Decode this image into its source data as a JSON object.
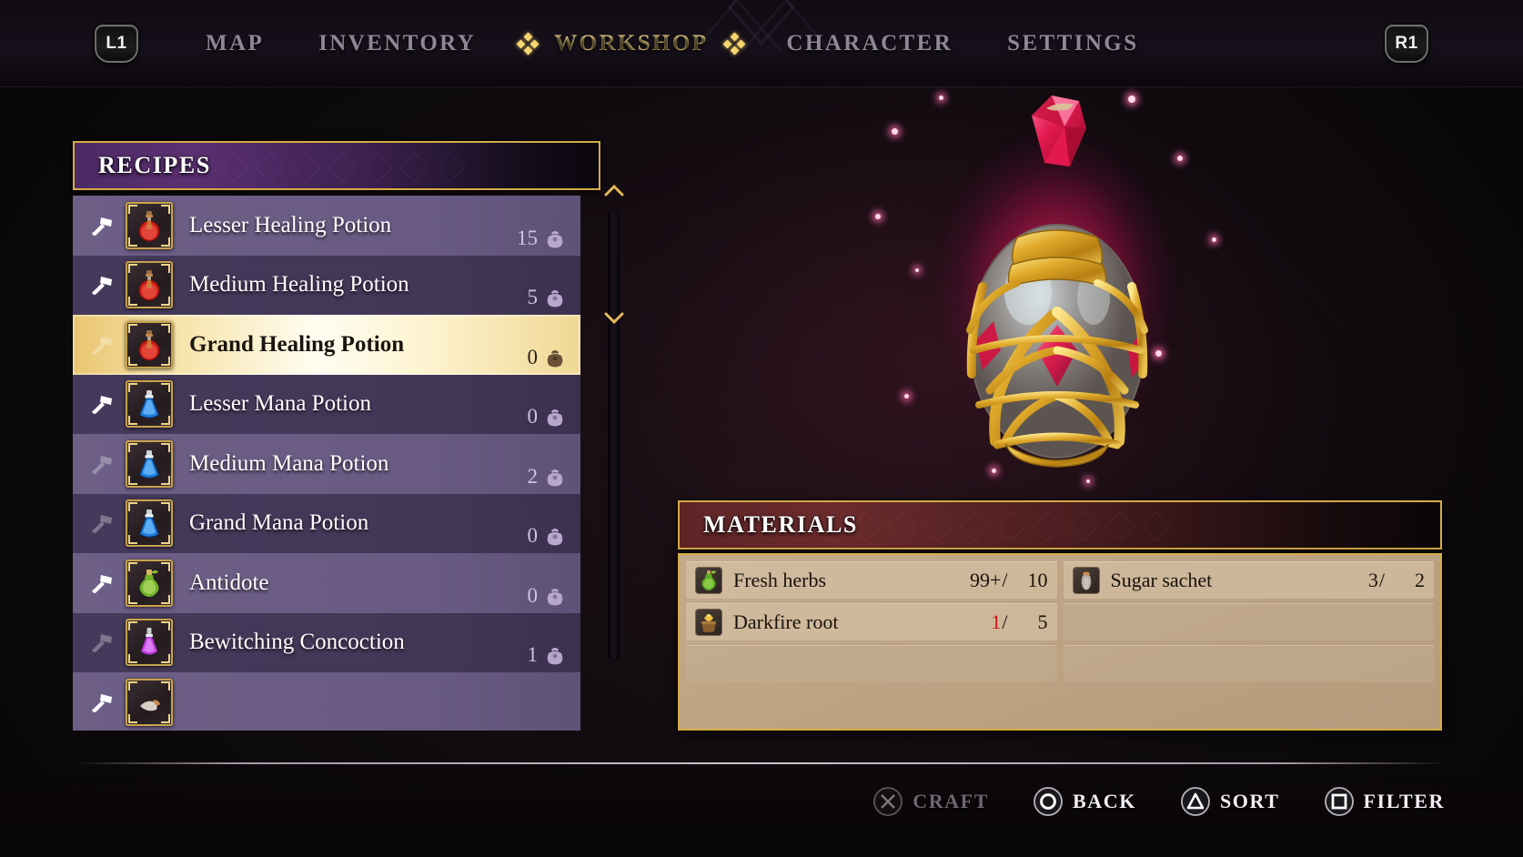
{
  "nav": {
    "left_shoulder": "L1",
    "right_shoulder": "R1",
    "items": [
      {
        "label": "MAP",
        "active": false
      },
      {
        "label": "INVENTORY",
        "active": false
      },
      {
        "label": "WORKSHOP",
        "active": true
      },
      {
        "label": "CHARACTER",
        "active": false
      },
      {
        "label": "SETTINGS",
        "active": false
      }
    ]
  },
  "recipes": {
    "title": "RECIPES",
    "scroll_up_icon": "chevron-up-icon",
    "scroll_down_icon": "chevron-down-icon",
    "qty_icon": "pouch-icon",
    "craftable_icon": "hammer-icon",
    "items": [
      {
        "name": "Lesser Healing Potion",
        "qty": "15",
        "potion": "red",
        "craftable": true,
        "selected": false
      },
      {
        "name": "Medium Healing Potion",
        "qty": "5",
        "potion": "red",
        "craftable": true,
        "selected": false
      },
      {
        "name": "Grand Healing Potion",
        "qty": "0",
        "potion": "red",
        "craftable": false,
        "selected": true
      },
      {
        "name": "Lesser Mana Potion",
        "qty": "0",
        "potion": "blue",
        "craftable": true,
        "selected": false
      },
      {
        "name": "Medium Mana Potion",
        "qty": "2",
        "potion": "blue",
        "craftable": false,
        "selected": false
      },
      {
        "name": "Grand Mana Potion",
        "qty": "0",
        "potion": "blue",
        "craftable": false,
        "selected": false
      },
      {
        "name": "Antidote",
        "qty": "0",
        "potion": "green",
        "craftable": true,
        "selected": false
      },
      {
        "name": "Bewitching Concoction",
        "qty": "1",
        "potion": "purple",
        "craftable": false,
        "selected": false
      }
    ]
  },
  "artwork": {
    "name": "grand-healing-potion-artwork",
    "glow_color": "#ff2a6e",
    "gold_color": "#d9a42b",
    "gem_color": "#e01b4c"
  },
  "materials": {
    "title": "MATERIALS",
    "slots": [
      {
        "name": "Fresh herbs",
        "have": "99+",
        "sep": "/",
        "need": "10",
        "low": false,
        "icon": "green-flask-icon",
        "empty": false
      },
      {
        "name": "Darkfire root",
        "have": "1",
        "sep": "/",
        "need": "5",
        "low": true,
        "icon": "root-basket-icon",
        "empty": false
      },
      {
        "name": "",
        "have": "",
        "sep": "",
        "need": "",
        "low": false,
        "icon": "",
        "empty": true
      },
      {
        "name": "Sugar sachet",
        "have": "3",
        "sep": "/",
        "need": "2",
        "low": false,
        "icon": "sachet-icon",
        "empty": false
      },
      {
        "name": "",
        "have": "",
        "sep": "",
        "need": "",
        "low": false,
        "icon": "",
        "empty": true
      },
      {
        "name": "",
        "have": "",
        "sep": "",
        "need": "",
        "low": false,
        "icon": "",
        "empty": true
      }
    ]
  },
  "bottom_bar": {
    "prompts": [
      {
        "label": "CRAFT",
        "button": "cross-button-icon",
        "disabled": true
      },
      {
        "label": "BACK",
        "button": "circle-button-icon",
        "disabled": false
      },
      {
        "label": "SORT",
        "button": "triangle-button-icon",
        "disabled": false
      },
      {
        "label": "FILTER",
        "button": "square-button-icon",
        "disabled": false
      }
    ]
  }
}
